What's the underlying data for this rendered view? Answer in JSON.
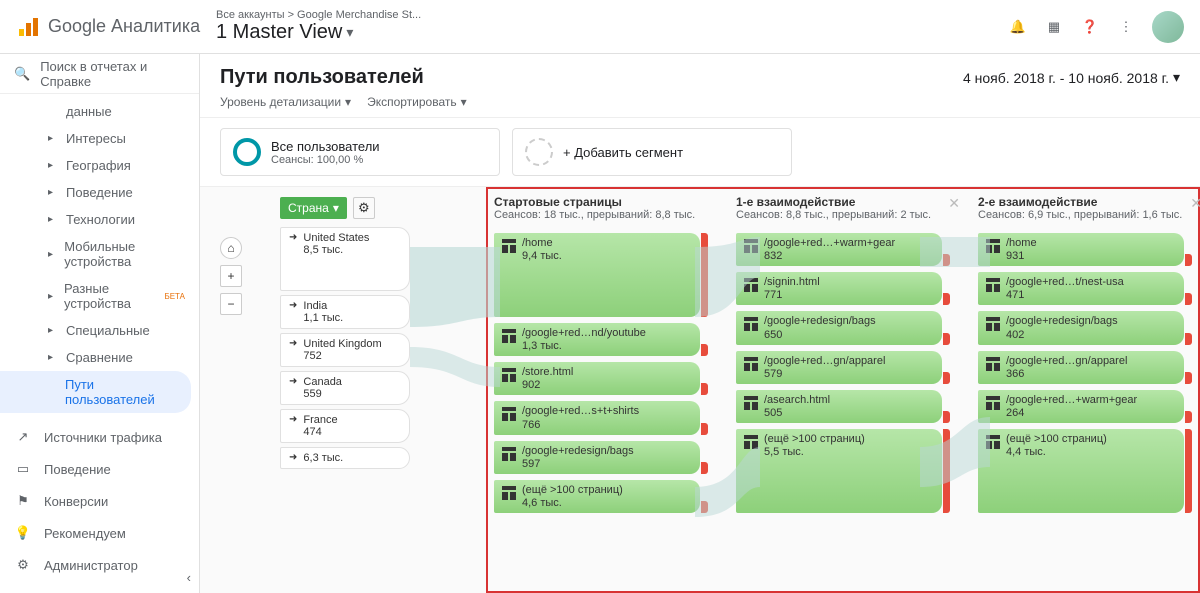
{
  "header": {
    "logo_text": "Google Аналитика",
    "breadcrumb_path": "Все аккаунты > Google Merchandise St...",
    "view_name": "1 Master View"
  },
  "search_placeholder": "Поиск в отчетах и Справке",
  "nav": {
    "subitems": [
      {
        "label": "данные",
        "has_chev": false
      },
      {
        "label": "Интересы",
        "has_chev": true
      },
      {
        "label": "География",
        "has_chev": true
      },
      {
        "label": "Поведение",
        "has_chev": true
      },
      {
        "label": "Технологии",
        "has_chev": true
      },
      {
        "label": "Мобильные устройства",
        "has_chev": true
      },
      {
        "label": "Разные устройства",
        "has_chev": true,
        "beta": "БЕТА"
      },
      {
        "label": "Специальные",
        "has_chev": true
      },
      {
        "label": "Сравнение",
        "has_chev": true
      },
      {
        "label": "Пути пользователей",
        "has_chev": false,
        "selected": true
      }
    ],
    "main": [
      {
        "icon": "↗",
        "label": "Источники трафика"
      },
      {
        "icon": "▭",
        "label": "Поведение"
      },
      {
        "icon": "⚑",
        "label": "Конверсии"
      },
      {
        "icon": "💡",
        "label": "Рекомендуем"
      },
      {
        "icon": "⚙",
        "label": "Администратор"
      }
    ]
  },
  "page": {
    "title": "Пути пользователей",
    "date_range": "4 нояб. 2018 г. - 10 нояб. 2018 г.",
    "toolbar": {
      "detail": "Уровень детализации",
      "export": "Экспортировать"
    }
  },
  "segments": {
    "all": {
      "title": "Все пользователи",
      "sub": "Сеансы: 100,00 %"
    },
    "add": "+ Добавить сегмент"
  },
  "dimension_select": "Страна",
  "countries": [
    {
      "name": "United States",
      "value": "8,5 тыс.",
      "tall": true
    },
    {
      "name": "India",
      "value": "1,1 тыс."
    },
    {
      "name": "United Kingdom",
      "value": "752"
    },
    {
      "name": "Canada",
      "value": "559"
    },
    {
      "name": "France",
      "value": "474"
    },
    {
      "name": "",
      "value": "6,3 тыс."
    }
  ],
  "columns": [
    {
      "title": "Стартовые страницы",
      "sub": "Сеансов: 18 тыс., прерываний: 8,8 тыс.",
      "nodes": [
        {
          "label": "/home",
          "value": "9,4 тыс.",
          "lg": true,
          "drop": "lg"
        },
        {
          "label": "/google+red…nd/youtube",
          "value": "1,3 тыс."
        },
        {
          "label": "/store.html",
          "value": "902"
        },
        {
          "label": "/google+red…s+t+shirts",
          "value": "766"
        },
        {
          "label": "/google+redesign/bags",
          "value": "597"
        },
        {
          "label": "(ещё >100 страниц)",
          "value": "4,6 тыс."
        }
      ]
    },
    {
      "title": "1-е взаимодействие",
      "sub": "Сеансов: 8,8 тыс., прерываний: 2 тыс.",
      "closable": true,
      "nodes": [
        {
          "label": "/google+red…+warm+gear",
          "value": "832"
        },
        {
          "label": "/signin.html",
          "value": "771"
        },
        {
          "label": "/google+redesign/bags",
          "value": "650"
        },
        {
          "label": "/google+red…gn/apparel",
          "value": "579"
        },
        {
          "label": "/asearch.html",
          "value": "505"
        },
        {
          "label": "(ещё >100 страниц)",
          "value": "5,5 тыс.",
          "lg": true,
          "drop": "lg"
        }
      ]
    },
    {
      "title": "2-е взаимодействие",
      "sub": "Сеансов: 6,9 тыс., прерываний: 1,6 тыс.",
      "closable": true,
      "nodes": [
        {
          "label": "/home",
          "value": "931"
        },
        {
          "label": "/google+red…t/nest-usa",
          "value": "471"
        },
        {
          "label": "/google+redesign/bags",
          "value": "402"
        },
        {
          "label": "/google+red…gn/apparel",
          "value": "366"
        },
        {
          "label": "/google+red…+warm+gear",
          "value": "264"
        },
        {
          "label": "(ещё >100 страниц)",
          "value": "4,4 тыс.",
          "lg": true,
          "drop": "lg"
        }
      ]
    }
  ]
}
